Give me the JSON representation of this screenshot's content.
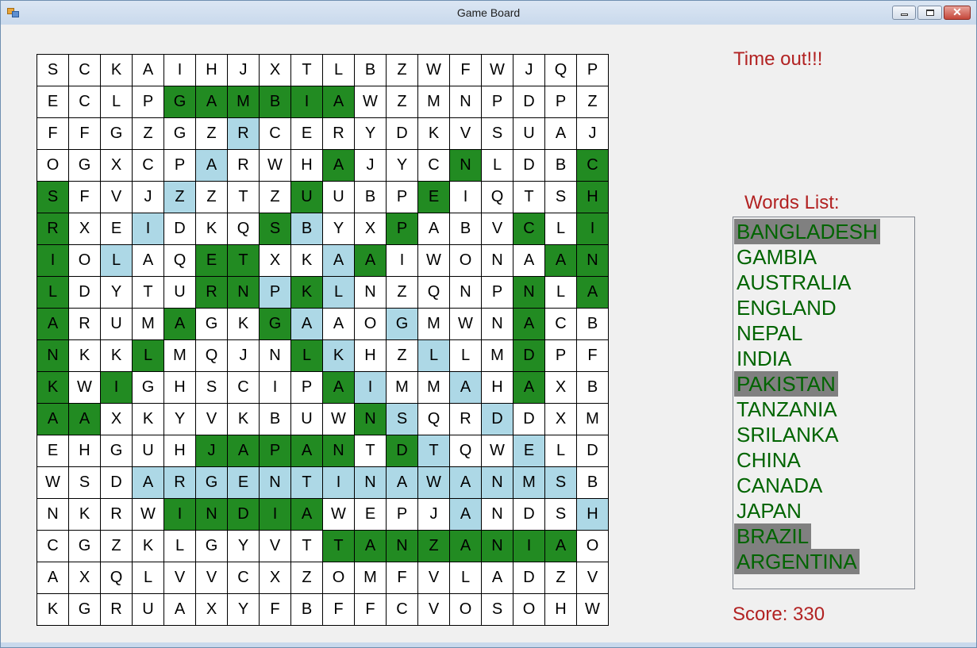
{
  "window": {
    "title": "Game Board"
  },
  "status": "Time out!!!",
  "words_label": "Words List:",
  "score_text": "Score: 330",
  "colors": {
    "found": "#228b22",
    "selected": "#add8e6",
    "word_text": "#006400",
    "label_text": "#b22222",
    "word_marked_bg": "#808080"
  },
  "grid": {
    "rows": [
      "SCKAIHJXTLBZWFWJQP",
      "ECLPGAMBIAWZMNPDPZ",
      "FFGZGZRCERYDKVSUAJ",
      "OGXCPARWHAJYCNLDBC",
      "SFVJZZTZUUBPEIQTSH",
      "RXEIDKQSBYXPABVCLI",
      "IOLAQETXKAAIWONAAN",
      "LDYTURNPKLNZQNPNLA",
      "ARUMAGKGAAOGMWNACB",
      "NKKLMQJNLKHZLLMDPF",
      "KWIGHSCIPAIMMAHAXB",
      "AAXKYVKBUWNSQRDDXM",
      "EHGUHJAPANTDTQWELD",
      "WSDARGENTINAWANMSB",
      "NKRWINDIAWEPJANDSH",
      "CGZKLGYVTTANZANIAO",
      "AXQLVVCXZOMFVLADZV",
      "KGRUAXYFBFFCVOSOHW"
    ],
    "states": [
      "..................",
      "....GGGGGG........",
      "......S...........",
      ".....S...G...G...G",
      "G...S...G...G....G",
      "G..S...GS..G...G.G",
      "G.S..GG..SG.....GG",
      "G....GGSGS.....G.G",
      "G...G..GS..S...G..",
      "G..G....GS..S..G..",
      "G.G......GS..S.G..",
      "GG........GS..S...",
      ".....GGGGG.GS..S..",
      "...SSSSSSSSSSSSSS.",
      "....GGGGG....S...S",
      ".........GGGGGGGG.",
      "..................",
      ".................."
    ]
  },
  "words": [
    {
      "text": "BANGLADESH",
      "marked": true
    },
    {
      "text": "GAMBIA",
      "marked": false
    },
    {
      "text": "AUSTRALIA",
      "marked": false
    },
    {
      "text": "ENGLAND",
      "marked": false
    },
    {
      "text": "NEPAL",
      "marked": false
    },
    {
      "text": "INDIA",
      "marked": false
    },
    {
      "text": "PAKISTAN",
      "marked": true
    },
    {
      "text": "TANZANIA",
      "marked": false
    },
    {
      "text": "SRILANKA",
      "marked": false
    },
    {
      "text": "CHINA",
      "marked": false
    },
    {
      "text": "CANADA",
      "marked": false
    },
    {
      "text": "JAPAN",
      "marked": false
    },
    {
      "text": "BRAZIL",
      "marked": true
    },
    {
      "text": "ARGENTINA",
      "marked": true
    }
  ]
}
